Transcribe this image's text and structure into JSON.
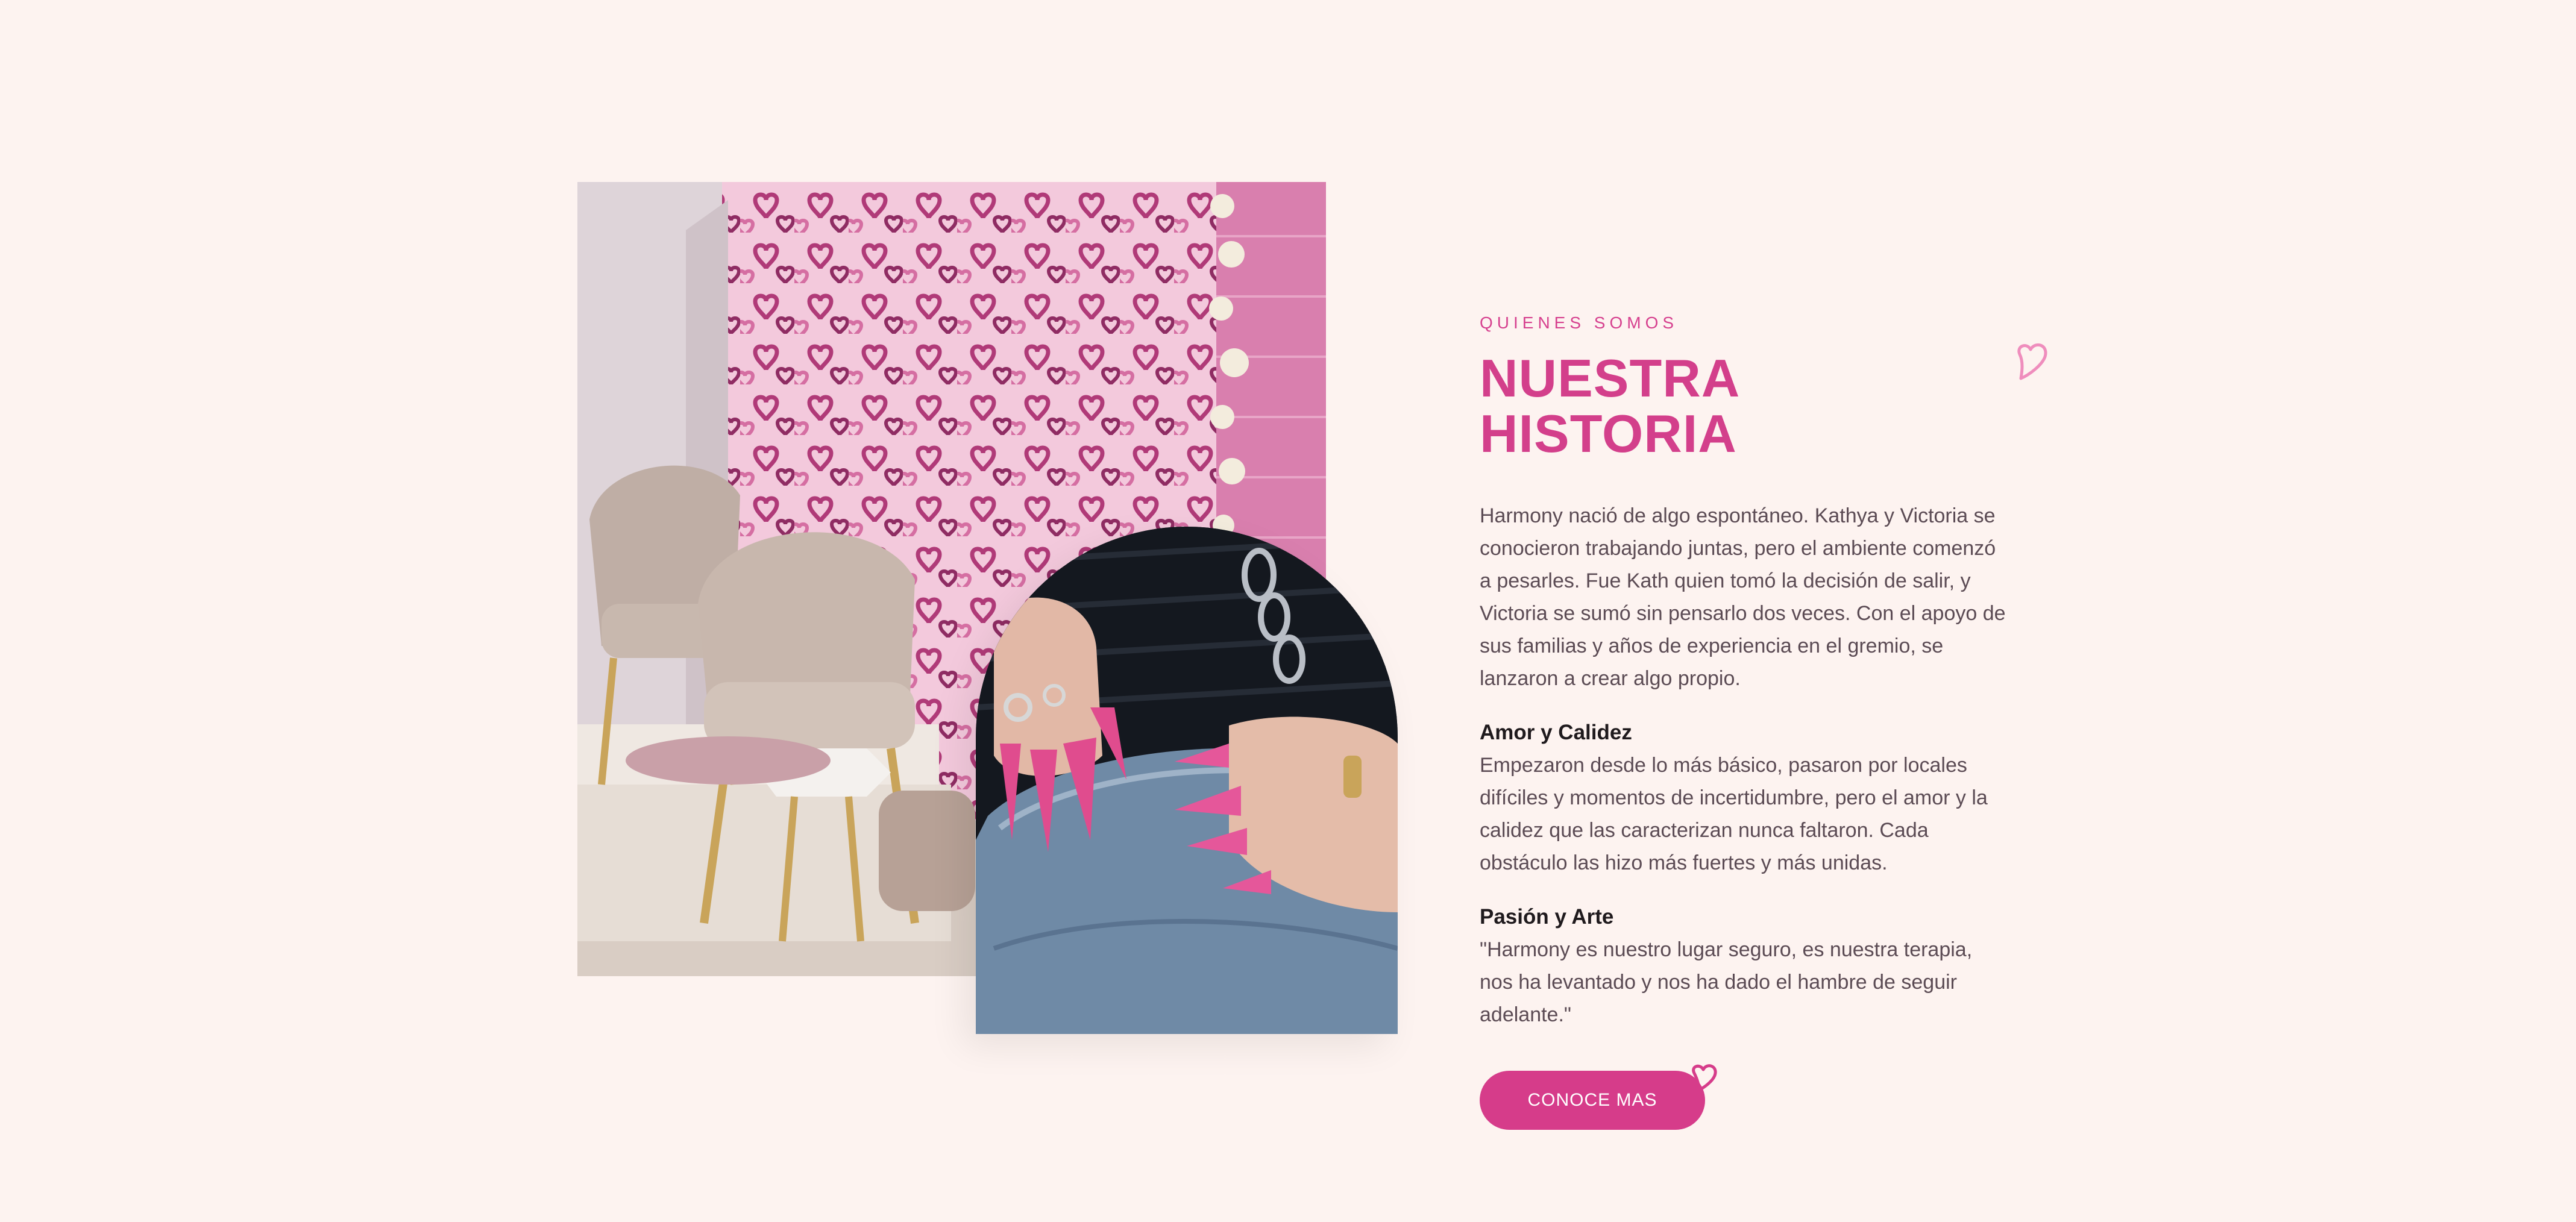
{
  "about": {
    "eyebrow": "QUIENES SOMOS",
    "title": "NUESTRA HISTORIA",
    "intro": "Harmony nació de algo espontáneo. Kathya y Victoria se conocieron trabajando juntas, pero el ambiente comenzó a pesarles. Fue Kath quien tomó la decisión de salir, y Victoria se sumó sin pensarlo dos veces. Con el apoyo de sus familias y años de experiencia en el gremio, se lanzaron a crear algo propio.",
    "sections": [
      {
        "title": "Amor y Calidez",
        "text": "Empezaron desde lo más básico, pasaron por locales difíciles y momentos de incertidumbre, pero el amor y la calidez que las caracterizan nunca faltaron. Cada obstáculo las hizo más fuertes y más unidas."
      },
      {
        "title": "Pasión y Arte",
        "text": "\"Harmony es nuestro lugar seguro, es nuestra terapia, nos ha levantado y nos ha dado el hambre de seguir adelante.\""
      }
    ],
    "cta_label": "CONOCE MAS"
  },
  "images": {
    "salon_photo": "salon-interior-heart-wall",
    "nails_photo": "pink-stiletto-nails-hands"
  },
  "icons": {
    "title_heart": "heart-outline-icon",
    "cta_heart": "heart-outline-icon"
  },
  "colors": {
    "background": "#fdf3f0",
    "accent": "#d33f8b",
    "body_text": "#5b4b54",
    "subheading": "#1f1a1d"
  }
}
